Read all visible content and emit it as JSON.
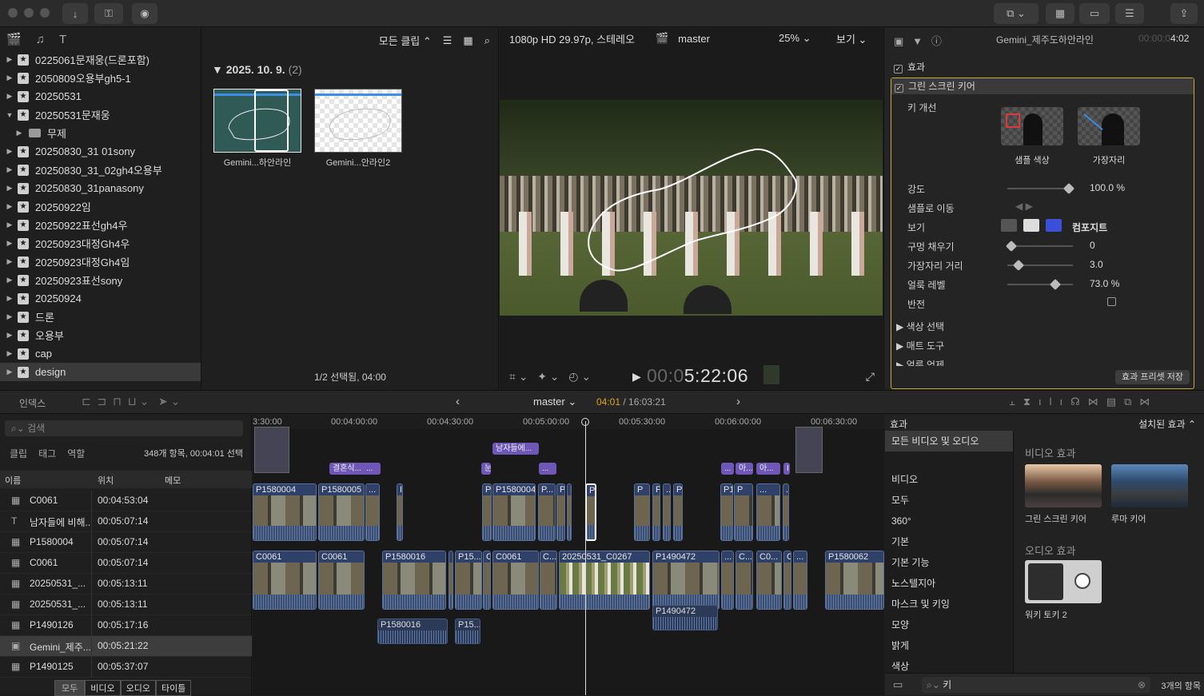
{
  "library": {
    "events": [
      {
        "label": "0225061문재웅(드론포함)",
        "expanded": false,
        "indent": 0
      },
      {
        "label": "2050809오용부gh5-1",
        "expanded": false,
        "indent": 0
      },
      {
        "label": "20250531",
        "expanded": false,
        "indent": 0
      },
      {
        "label": "20250531문재웅",
        "expanded": true,
        "indent": 0
      },
      {
        "label": "무제",
        "expanded": false,
        "indent": 1,
        "folder": true
      },
      {
        "label": "20250830_31 01sony",
        "expanded": false,
        "indent": 0
      },
      {
        "label": "20250830_31_02gh4오용부",
        "expanded": false,
        "indent": 0
      },
      {
        "label": "20250830_31panasony",
        "expanded": false,
        "indent": 0
      },
      {
        "label": "20250922임",
        "expanded": false,
        "indent": 0
      },
      {
        "label": "20250922표선gh4우",
        "expanded": false,
        "indent": 0
      },
      {
        "label": "20250923대정Gh4우",
        "expanded": false,
        "indent": 0
      },
      {
        "label": "20250923대정Gh4임",
        "expanded": false,
        "indent": 0
      },
      {
        "label": "20250923표선sony",
        "expanded": false,
        "indent": 0
      },
      {
        "label": "20250924",
        "expanded": false,
        "indent": 0
      },
      {
        "label": "드론",
        "expanded": false,
        "indent": 0
      },
      {
        "label": "오용부",
        "expanded": false,
        "indent": 0
      },
      {
        "label": "cap",
        "expanded": false,
        "indent": 0
      },
      {
        "label": "design",
        "expanded": false,
        "indent": 0,
        "selected": true
      }
    ]
  },
  "browser": {
    "filter_label": "모든 클립",
    "date_label": "2025. 10. 9.",
    "count_label": "(2)",
    "clips": [
      {
        "label": "Gemini...하안라인"
      },
      {
        "label": "Gemini...안라인2"
      }
    ],
    "status": "1/2 선택됨, 04:00"
  },
  "viewer": {
    "format": "1080p HD 29.97p, 스테레오",
    "project": "master",
    "zoom": "25%",
    "view_label": "보기",
    "timecode_dim": "00:0",
    "timecode": "5:22:06"
  },
  "inspector": {
    "clip_name": "Gemini_제주도하안라인",
    "duration_dim": "00:00:0",
    "duration": "4:02",
    "effects_label": "효과",
    "keyer_label": "그린 스크린 키어",
    "refine_label": "키 개선",
    "sample_color": "샘플 색상",
    "edges": "가장자리",
    "params": [
      {
        "label": "강도",
        "value": "100.0  %",
        "pos": 0.95
      },
      {
        "label": "샘플로 이동",
        "value": "",
        "pos": null
      },
      {
        "label": "보기",
        "value": "컴포지트",
        "pos": null
      },
      {
        "label": "구멍 채우기",
        "value": "0",
        "pos": 0.0
      },
      {
        "label": "가장자리 거리",
        "value": "3.0",
        "pos": 0.12
      },
      {
        "label": "얼룩 레벨",
        "value": "73.0  %",
        "pos": 0.73
      },
      {
        "label": "반전",
        "value": "",
        "pos": null
      }
    ],
    "color_select": "색상 선택",
    "matte_tools": "매트 도구",
    "light_wrap": "얼룩 억제",
    "save_preset": "효과 프리셋 저장"
  },
  "timeline_bar": {
    "index_label": "인덱스",
    "project": "master",
    "pos": "04:01",
    "total": "/ 16:03:21"
  },
  "index": {
    "search_placeholder": "검색",
    "tabs": [
      "클립",
      "태그",
      "역할"
    ],
    "summary": "348개 항목, 00:04:01 선택",
    "columns": [
      "이름",
      "위치",
      "메모"
    ],
    "rows": [
      {
        "icon": "film",
        "name": "C0061",
        "pos": "00:04:53:04"
      },
      {
        "icon": "title",
        "name": "남자들에 비해...",
        "pos": "00:05:07:14"
      },
      {
        "icon": "film",
        "name": "P1580004",
        "pos": "00:05:07:14"
      },
      {
        "icon": "film",
        "name": "C0061",
        "pos": "00:05:07:14"
      },
      {
        "icon": "film",
        "name": "20250531_...",
        "pos": "00:05:13:11"
      },
      {
        "icon": "film",
        "name": "20250531_...",
        "pos": "00:05:13:11"
      },
      {
        "icon": "film",
        "name": "P1490126",
        "pos": "00:05:17:16"
      },
      {
        "icon": "image",
        "name": "Gemini_제주...",
        "pos": "00:05:21:22",
        "selected": true
      },
      {
        "icon": "film",
        "name": "P1490125",
        "pos": "00:05:37:07"
      }
    ],
    "bottom_tabs": [
      "모두",
      "비디오",
      "오디오",
      "타이틀"
    ]
  },
  "timeline": {
    "ruler": [
      "3:30:00",
      "00:04:00:00",
      "00:04:30:00",
      "00:05:00:00",
      "00:05:30:00",
      "00:06:00:00",
      "00:06:30:00"
    ],
    "titles": [
      "결혼식...",
      "...",
      "남자들에...",
      "눈",
      "...",
      "...",
      "아...",
      "아...",
      "I"
    ],
    "upper_clips": [
      "P1580004",
      "P1580005",
      "...",
      "I",
      "P",
      "P1580004",
      "P...",
      "P'",
      "P...",
      "P",
      "P",
      "P",
      "...",
      "P...",
      "P1...",
      "P",
      "...",
      "..."
    ],
    "main_clips": [
      "C0061",
      "C0061",
      "P1580016",
      "I",
      "P15...",
      "C",
      "C0061",
      "C...",
      "20250531_C0267",
      "P1490472",
      "...",
      "C...",
      "C0...",
      "C",
      "...",
      "P1580062"
    ],
    "audio_clips": [
      "P1580016",
      "P15...",
      "P1490472"
    ]
  },
  "effects": {
    "header": "효과",
    "installed": "설치된 효과",
    "categories": [
      "모든 비디오 및 오디오",
      "비디오",
      "모두",
      "360°",
      "기본",
      "기본 기능",
      "노스텔지아",
      "마스크 및 키잉",
      "모양",
      "밝게",
      "색상"
    ],
    "video_section": "비디오 효과",
    "audio_section": "오디오 효과",
    "video_items": [
      "그린 스크린 키어",
      "루마 키어"
    ],
    "audio_items": [
      "워키 토키 2"
    ],
    "search_value": "키",
    "count": "3개의 항목"
  }
}
